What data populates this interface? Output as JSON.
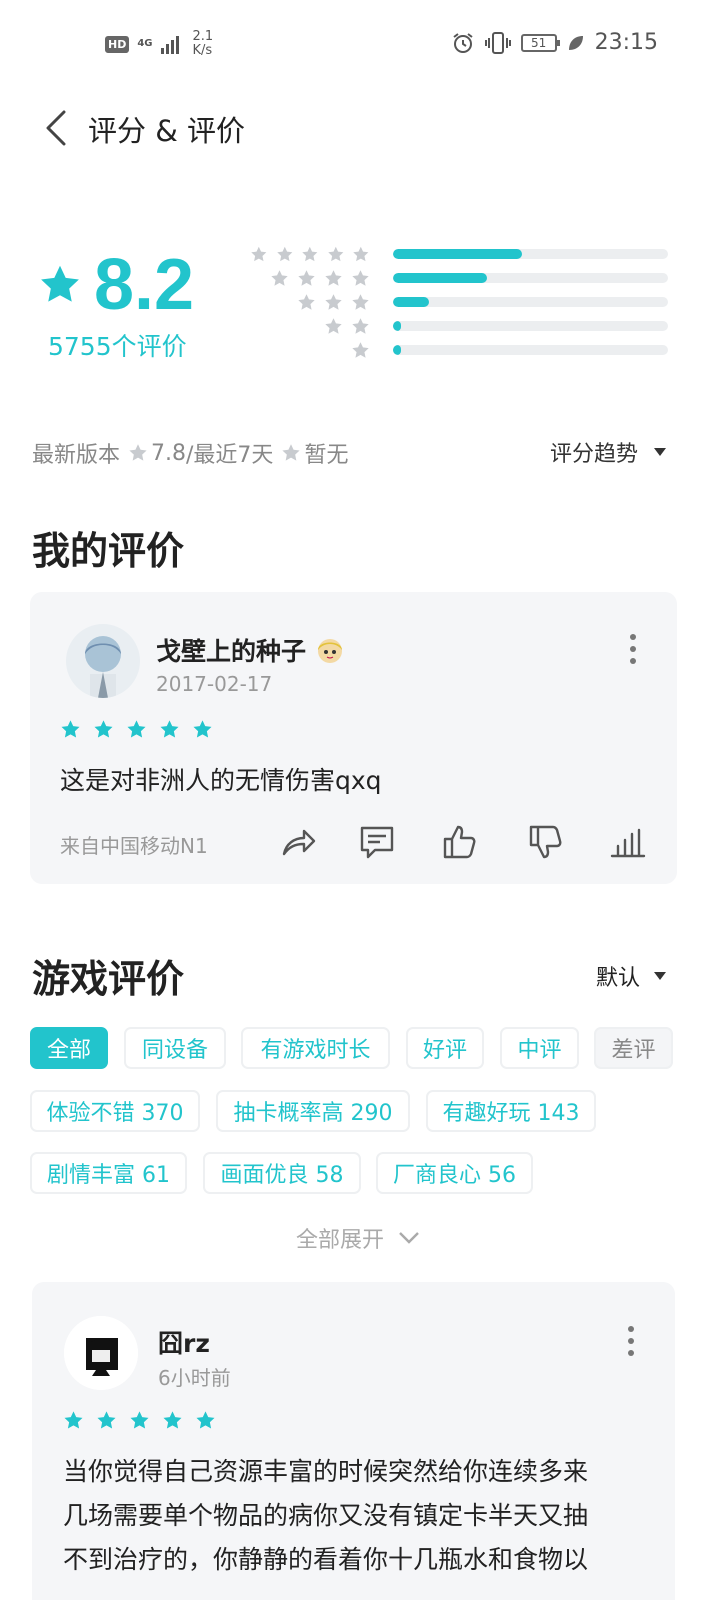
{
  "status_bar": {
    "hd": "HD",
    "network": "4G",
    "speed_value": "2.1",
    "speed_unit": "K/s",
    "battery": "51",
    "time": "23:15"
  },
  "header": {
    "title": "评分 & 评价"
  },
  "rating": {
    "score": "8.2",
    "count_text": "5755个评价",
    "distribution": [
      {
        "stars": 5,
        "fraction": 0.47
      },
      {
        "stars": 4,
        "fraction": 0.34
      },
      {
        "stars": 3,
        "fraction": 0.13
      },
      {
        "stars": 2,
        "fraction": 0.03
      },
      {
        "stars": 1,
        "fraction": 0.03
      }
    ],
    "latest_version_label": "最新版本",
    "latest_version_score": "7.8",
    "recent_label": "/最近7天",
    "recent_score": "暂无",
    "trend_label": "评分趋势"
  },
  "my_review": {
    "section_title": "我的评价",
    "user_name": "戈壁上的种子",
    "date": "2017-02-17",
    "stars": 5,
    "text": "这是对非洲人的无情伤害qxq",
    "device": "来自中国移动N1"
  },
  "game_reviews": {
    "section_title": "游戏评价",
    "sort_label": "默认",
    "filters": [
      "全部",
      "同设备",
      "有游戏时长",
      "好评",
      "中评",
      "差评"
    ],
    "tags": [
      "体验不错 370",
      "抽卡概率高 290",
      "有趣好玩 143",
      "剧情丰富 61",
      "画面优良 58",
      "厂商良心 56"
    ],
    "expand_label": "全部展开",
    "first_review": {
      "user_name": "囧rz",
      "time": "6小时前",
      "stars": 5,
      "text_lines": [
        "当你觉得自己资源丰富的时候突然给你连续多来",
        "几场需要单个物品的病你又没有镇定卡半天又抽",
        "不到治疗的，你静静的看着你十几瓶水和食物以"
      ]
    }
  },
  "colors": {
    "accent": "#22c4cc",
    "card_bg": "#f5f6f8"
  }
}
